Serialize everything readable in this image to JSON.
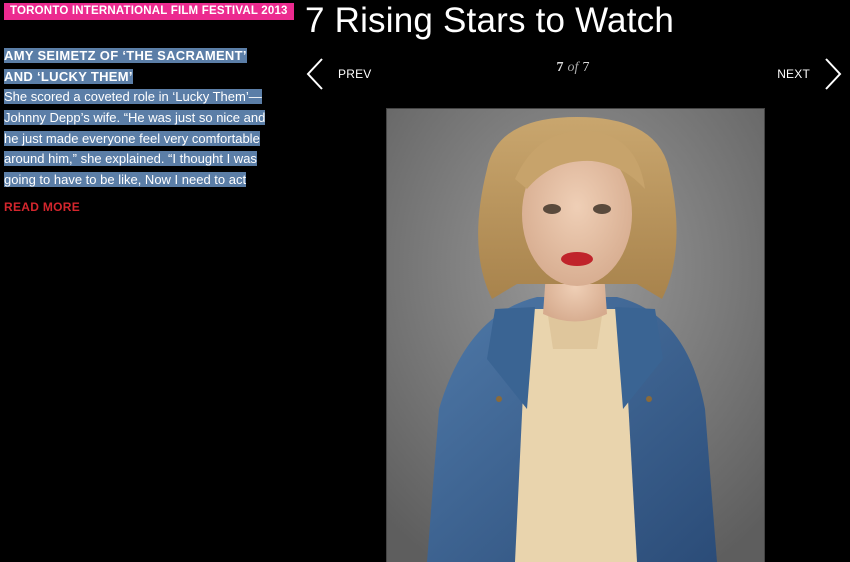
{
  "festival_tag": "TORONTO INTERNATIONAL FILM FESTIVAL 2013",
  "page_title": "7 Rising Stars to Watch",
  "article": {
    "headline_lines": [
      "AMY SEIMETZ OF ‘THE SACRAMENT’",
      "AND ‘LUCKY THEM’"
    ],
    "body_lines": [
      "She scored a coveted role in ‘Lucky Them’—",
      "Johnny Depp’s wife. “He was just so nice and",
      "he just made everyone feel very comfortable",
      "around him,” she explained. “I thought I was",
      "going to have to be like, Now I need to act"
    ],
    "read_more_label": "READ MORE"
  },
  "gallery": {
    "prev_label": "PREV",
    "next_label": "NEXT",
    "current": "7",
    "of_label": "of",
    "total": "7"
  },
  "colors": {
    "tag_bg": "#ec2a8f",
    "selection": "#5b7ea7",
    "read_more": "#d4262d",
    "background": "#000000"
  },
  "icons": {
    "prev": "chevron-left-icon",
    "next": "chevron-right-icon"
  }
}
